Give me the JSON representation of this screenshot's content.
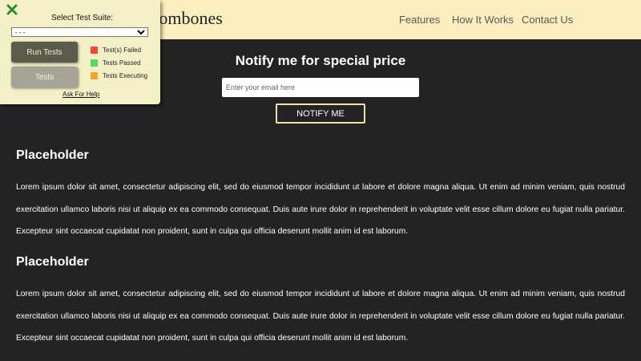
{
  "header": {
    "brand": "Original Trombones",
    "nav": [
      "Features",
      "How It Works",
      "Contact Us"
    ]
  },
  "hero": {
    "title": "Notify me for special price",
    "email_placeholder": "Enter your email here",
    "button_label": "NOTIFY ME"
  },
  "sections": [
    {
      "heading": "Placeholder",
      "text": "Lorem ipsum dolor sit amet, consectetur adipiscing elit, sed do eiusmod tempor incididunt ut labore et dolore magna aliqua. Ut enim ad minim veniam, quis nostrud exercitation ullamco laboris nisi ut aliquip ex ea commodo consequat. Duis aute irure dolor in reprehenderit in voluptate velit esse cillum dolore eu fugiat nulla pariatur. Excepteur sint occaecat cupidatat non proident, sunt in culpa qui officia deserunt mollit anim id est laborum."
    },
    {
      "heading": "Placeholder",
      "text": "Lorem ipsum dolor sit amet, consectetur adipiscing elit, sed do eiusmod tempor incididunt ut labore et dolore magna aliqua. Ut enim ad minim veniam, quis nostrud exercitation ullamco laboris nisi ut aliquip ex ea commodo consequat. Duis aute irure dolor in reprehenderit in voluptate velit esse cillum dolore eu fugiat nulla pariatur. Excepteur sint occaecat cupidatat non proident, sunt in culpa qui officia deserunt mollit anim id est laborum."
    }
  ],
  "test_panel": {
    "close_icon": "close-icon",
    "suite_label": "Select Test Suite:",
    "suite_selected": "- - -",
    "run_button": "Run Tests",
    "tests_button": "Tests",
    "legend": [
      {
        "label": "Test(s) Failed",
        "color": "#f04a3a"
      },
      {
        "label": "Tests Passed",
        "color": "#5fd45f"
      },
      {
        "label": "Tests Executing",
        "color": "#f5a623"
      }
    ],
    "help_link": "Ask For Help"
  },
  "colors": {
    "header_bg": "#fdeec0",
    "page_bg": "#232323",
    "panel_bg": "#f3f0c7",
    "close_icon": "#2e8b2e",
    "button_border": "#f1dfaa"
  }
}
